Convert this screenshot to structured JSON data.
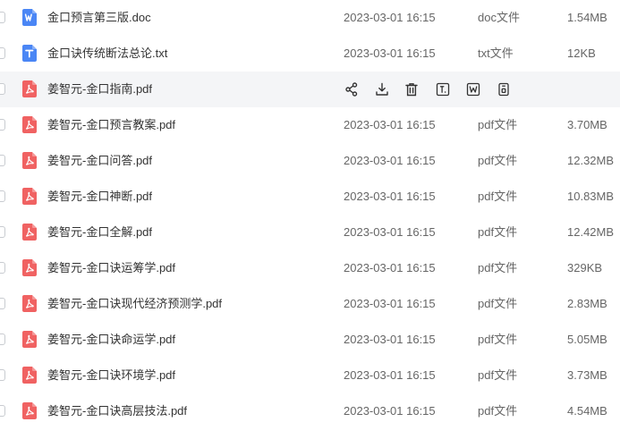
{
  "colors": {
    "word": "#4a86f5",
    "txt": "#4a86f5",
    "pdf": "#f06262",
    "hover_bg": "#f4f5f7",
    "text": "#333333",
    "muted": "#666666"
  },
  "files": [
    {
      "name": "金口预言第三版.doc",
      "icon": "word-file-icon",
      "kind": "word",
      "date": "2023-03-01 16:15",
      "type": "doc文件",
      "size": "1.54MB"
    },
    {
      "name": "金口诀传统断法总论.txt",
      "icon": "txt-file-icon",
      "kind": "txt",
      "date": "2023-03-01 16:15",
      "type": "txt文件",
      "size": "12KB"
    },
    {
      "name": "姜智元-金口指南.pdf",
      "icon": "pdf-file-icon",
      "kind": "pdf",
      "date": "",
      "type": "",
      "size": "",
      "hover": true
    },
    {
      "name": "姜智元-金口预言教案.pdf",
      "icon": "pdf-file-icon",
      "kind": "pdf",
      "date": "2023-03-01 16:15",
      "type": "pdf文件",
      "size": "3.70MB"
    },
    {
      "name": "姜智元-金口问答.pdf",
      "icon": "pdf-file-icon",
      "kind": "pdf",
      "date": "2023-03-01 16:15",
      "type": "pdf文件",
      "size": "12.32MB"
    },
    {
      "name": "姜智元-金口神断.pdf",
      "icon": "pdf-file-icon",
      "kind": "pdf",
      "date": "2023-03-01 16:15",
      "type": "pdf文件",
      "size": "10.83MB"
    },
    {
      "name": "姜智元-金口全解.pdf",
      "icon": "pdf-file-icon",
      "kind": "pdf",
      "date": "2023-03-01 16:15",
      "type": "pdf文件",
      "size": "12.42MB"
    },
    {
      "name": "姜智元-金口诀运筹学.pdf",
      "icon": "pdf-file-icon",
      "kind": "pdf",
      "date": "2023-03-01 16:15",
      "type": "pdf文件",
      "size": "329KB"
    },
    {
      "name": "姜智元-金口诀现代经济预测学.pdf",
      "icon": "pdf-file-icon",
      "kind": "pdf",
      "date": "2023-03-01 16:15",
      "type": "pdf文件",
      "size": "2.83MB"
    },
    {
      "name": "姜智元-金口诀命运学.pdf",
      "icon": "pdf-file-icon",
      "kind": "pdf",
      "date": "2023-03-01 16:15",
      "type": "pdf文件",
      "size": "5.05MB"
    },
    {
      "name": "姜智元-金口诀环境学.pdf",
      "icon": "pdf-file-icon",
      "kind": "pdf",
      "date": "2023-03-01 16:15",
      "type": "pdf文件",
      "size": "3.73MB"
    },
    {
      "name": "姜智元-金口诀高层技法.pdf",
      "icon": "pdf-file-icon",
      "kind": "pdf",
      "date": "2023-03-01 16:15",
      "type": "pdf文件",
      "size": "4.54MB"
    }
  ],
  "hover_actions": [
    {
      "name": "share-icon"
    },
    {
      "name": "download-icon"
    },
    {
      "name": "delete-icon"
    },
    {
      "name": "text-extract-icon"
    },
    {
      "name": "convert-to-word-icon"
    },
    {
      "name": "more-file-icon"
    }
  ]
}
